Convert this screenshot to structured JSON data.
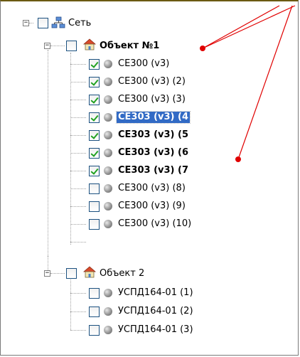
{
  "tree": {
    "root": {
      "label": "Сеть",
      "expander": "−",
      "icon": "network-icon"
    },
    "object1": {
      "label": "Объект №1",
      "expander": "−",
      "icon": "house-icon",
      "children": [
        {
          "label": "CE300 (v3)",
          "checked": true
        },
        {
          "label": "CE300 (v3) (2)",
          "checked": true
        },
        {
          "label": "CE300 (v3) (3)",
          "checked": true
        },
        {
          "label": "CE303 (v3) (4",
          "checked": true,
          "selected": true,
          "bold": true
        },
        {
          "label": "CE303 (v3) (5",
          "checked": true,
          "bold": true
        },
        {
          "label": "CE303 (v3) (6",
          "checked": true,
          "bold": true
        },
        {
          "label": "CE303 (v3) (7",
          "checked": true,
          "bold": true
        },
        {
          "label": "CE300 (v3) (8)",
          "checked": false
        },
        {
          "label": "CE300 (v3) (9)",
          "checked": false
        },
        {
          "label": "CE300 (v3) (10)",
          "checked": false
        }
      ]
    },
    "object2": {
      "label": "Объект 2",
      "expander": "−",
      "icon": "house-icon",
      "children": [
        {
          "label": "УСПД164-01 (1)",
          "checked": false
        },
        {
          "label": "УСПД164-01 (2)",
          "checked": false
        },
        {
          "label": "УСПД164-01 (3)",
          "checked": false
        }
      ]
    }
  },
  "colors": {
    "selection": "#316ac5",
    "checkmark": "#21a121",
    "annotation_arrow": "#e00000"
  }
}
